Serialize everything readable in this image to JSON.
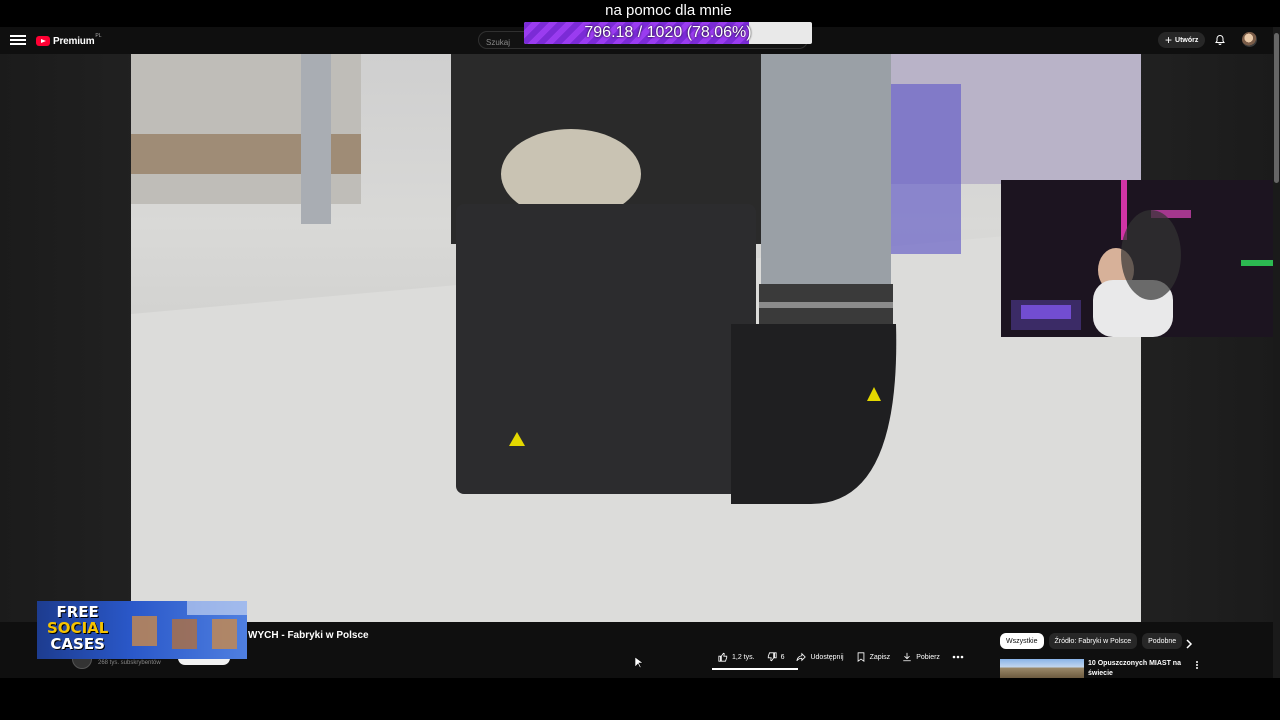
{
  "overlay": {
    "goal_title": "na pomoc dla mnie",
    "goal_progress_text": "796.18 / 1020 (78.06%)",
    "goal_current": 796.18,
    "goal_target": 1020,
    "goal_percent": 78.06,
    "goal_color": "#8a35e6"
  },
  "header": {
    "logo_text": "Premium",
    "logo_country": "PL",
    "search_placeholder": "Szukaj",
    "create_label": "Utwórz"
  },
  "video": {
    "title": "WYCH - Fabryki w Polsce",
    "channel_subscribers": "268 tys. subskrybentów"
  },
  "ad": {
    "line1": "FREE",
    "line2": "SOCIAL",
    "line3": "CASES"
  },
  "actions": {
    "likes": "1,2 tys.",
    "dislikes": "6",
    "share": "Udostępnij",
    "save": "Zapisz",
    "download": "Pobierz"
  },
  "sidebar": {
    "chips": [
      "Wszystkie",
      "Źródło: Fabryki w Polsce",
      "Podobne"
    ],
    "recommendation_title": "10 Opuszczonych MIAST na świecie"
  },
  "colors": {
    "youtube_red": "#ff0033",
    "background": "#0f0f0f"
  }
}
